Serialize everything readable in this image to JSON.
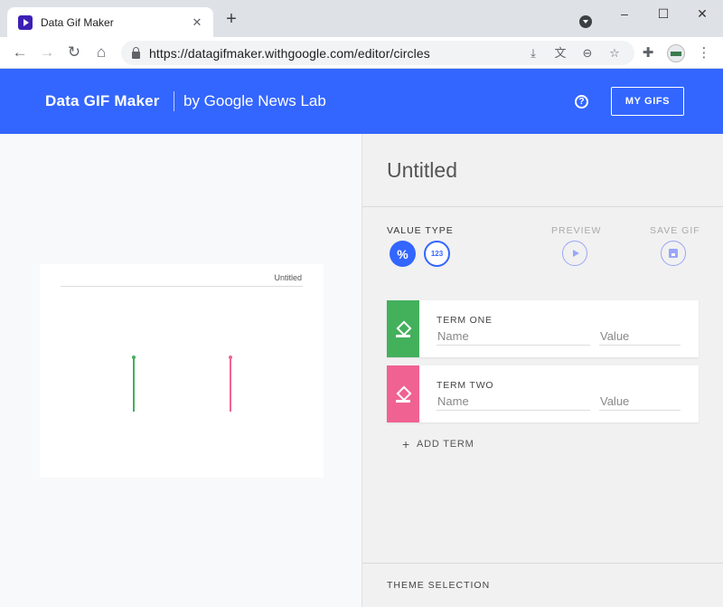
{
  "browser": {
    "tab_title": "Data Gif Maker",
    "url": "https://datagifmaker.withgoogle.com/editor/circles",
    "new_tab_symbol": "+",
    "window_controls": {
      "minimize": "–",
      "maximize": "☐",
      "close": "✕"
    }
  },
  "header": {
    "brand": "Data GIF Maker",
    "byline": "by Google News Lab",
    "help_symbol": "?",
    "my_gifs_label": "MY GIFS",
    "accent_color": "#3366ff"
  },
  "preview": {
    "canvas_title": "Untitled",
    "term_colors": [
      "#43b05c",
      "#f06292"
    ]
  },
  "editor": {
    "title": "Untitled",
    "value_type_label": "VALUE TYPE",
    "value_type_options": [
      "%",
      "123"
    ],
    "selected_value_type": "%",
    "preview_label": "PREVIEW",
    "save_gif_label": "SAVE GIF",
    "terms": [
      {
        "label": "TERM ONE",
        "name_placeholder": "Name",
        "value_placeholder": "Value",
        "color": "#43b05c"
      },
      {
        "label": "TERM TWO",
        "name_placeholder": "Name",
        "value_placeholder": "Value",
        "color": "#f06292"
      }
    ],
    "add_term_label": "ADD TERM",
    "theme_selection_label": "THEME SELECTION"
  }
}
